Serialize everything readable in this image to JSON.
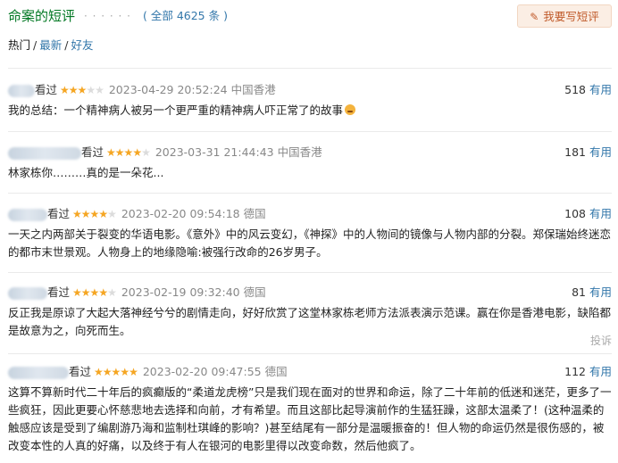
{
  "header": {
    "title": "命案的短评",
    "dots": "· · · · · ·",
    "total": "( 全部 4625 条 )",
    "write_button": "我要写短评",
    "pen_icon": "pencil-icon"
  },
  "tabs": [
    {
      "label": "热门",
      "active": true
    },
    {
      "label": "最新",
      "active": false
    },
    {
      "label": "好友",
      "active": false
    }
  ],
  "tab_separator": "/",
  "comments": [
    {
      "watched": "看过",
      "stars": 3,
      "time": "2023-04-29 20:52:24",
      "location": "中国香港",
      "votes": "518",
      "useful": "有用",
      "text": "我的总结：一个精神病人被另一个更严重的精神病人吓正常了的故事",
      "emoji": "frown-emoji"
    },
    {
      "watched": "看过",
      "stars": 4,
      "time": "2023-03-31 21:44:43",
      "location": "中国香港",
      "votes": "181",
      "useful": "有用",
      "text": "林家栋你………真的是一朵花..."
    },
    {
      "watched": "看过",
      "stars": 4,
      "time": "2023-02-20 09:54:18",
      "location": "德国",
      "votes": "108",
      "useful": "有用",
      "text": "一天之内两部关于裂变的华语电影。《意外》中的风云变幻，《神探》中的人物间的镜像与人物内部的分裂。郑保瑞始终迷恋的都市末世景观。人物身上的地缘隐喻:被强行改命的26岁男子。"
    },
    {
      "watched": "看过",
      "stars": 4,
      "time": "2023-02-19 09:32:40",
      "location": "德国",
      "votes": "81",
      "useful": "有用",
      "text": "反正我是原谅了大起大落神经兮兮的剧情走向，好好欣赏了这堂林家栋老师方法派表演示范课。赢在你是香港电影，缺陷都是故意为之，向死而生。",
      "report": "投诉"
    },
    {
      "watched": "看过",
      "stars": 5,
      "time": "2023-02-20 09:47:55",
      "location": "德国",
      "votes": "112",
      "useful": "有用",
      "text": "这算不算新时代二十年后的疯癫版的“柔道龙虎榜”只是我们现在面对的世界和命运，除了二十年前的低迷和迷茫，更多了一些疯狂，因此更要心怀慈悲地去选择和向前，才有希望。而且这部比起导演前作的生猛狂躁，这部太温柔了！(这种温柔的触感应该是受到了编剧游乃海和监制杜琪峰的影响？)甚至结尾有一部分是温暖振奋的！但人物的命运仍然是很伤感的，被改变本性的人真的好痛，以及终于有人在银河的电影里得以改变命数，然后他疯了。"
    }
  ]
}
